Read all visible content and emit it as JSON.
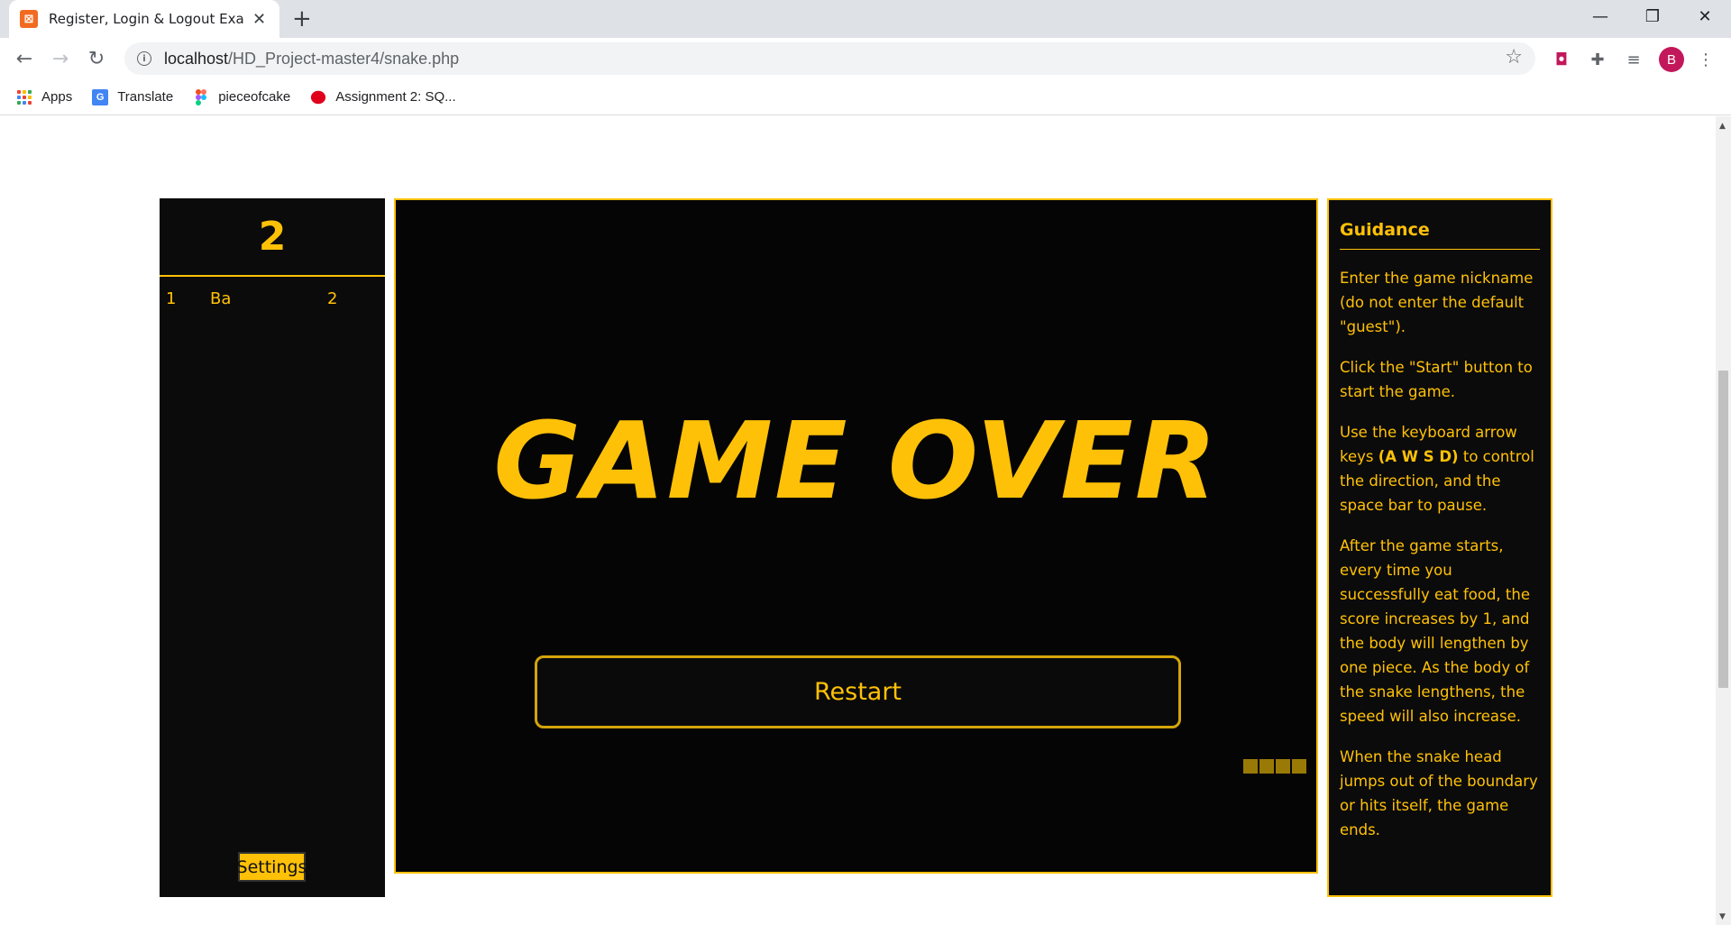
{
  "browser": {
    "tab_title": "Register, Login & Logout Exan",
    "new_tab": "+",
    "url_host": "localhost",
    "url_path": "/HD_Project-master4/snake.php",
    "avatar_letter": "B",
    "bookmarks": [
      {
        "label": "Apps",
        "icon": "apps-grid-icon"
      },
      {
        "label": "Translate",
        "icon": "google-translate-icon"
      },
      {
        "label": "pieceofcake",
        "icon": "figma-icon"
      },
      {
        "label": "Assignment 2: SQ...",
        "icon": "red-blob-icon"
      }
    ],
    "colors": {
      "accent": "#ffc107",
      "avatar": "#c2185b",
      "favicon": "#f26b21"
    }
  },
  "leaderboard": {
    "score": "2",
    "rows": [
      {
        "rank": "1",
        "name": "Ba",
        "score": "2"
      }
    ],
    "settings_label": "Settings"
  },
  "game": {
    "title": "GAME OVER",
    "restart_label": "Restart",
    "snake_length": 4
  },
  "guidance": {
    "title": "Guidance",
    "p1": "Enter the game nickname (do not enter the default \"guest\").",
    "p2": "Click the \"Start\" button to start the game.",
    "p3_before": "Use the keyboard arrow keys ",
    "p3_bold": "(A W S D)",
    "p3_after": " to control the direction, and the space bar to pause.",
    "p4": "After the game starts, every time you successfully eat food, the score increases by 1, and the body will lengthen by one piece. As the body of the snake lengthens, the speed will also increase.",
    "p5": "When the snake head jumps out of the boundary or hits itself, the game ends."
  }
}
